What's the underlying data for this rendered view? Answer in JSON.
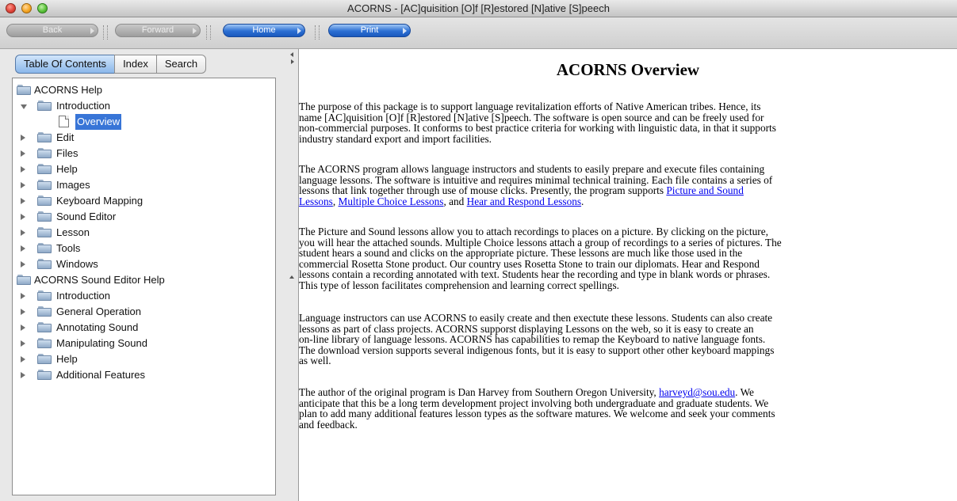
{
  "window": {
    "title": "ACORNS - [AC]quisition [O]f [R]estored [N]ative [S]peech"
  },
  "toolbar": {
    "back_label": "Back",
    "forward_label": "Forward",
    "home_label": "Home",
    "print_label": "Print"
  },
  "tabs": {
    "toc": "Table Of Contents",
    "index": "Index",
    "search": "Search"
  },
  "tree": {
    "acorns_help": "ACORNS Help",
    "introduction": "Introduction",
    "overview": "Overview",
    "edit": "Edit",
    "files": "Files",
    "help": "Help",
    "images": "Images",
    "keyboard_mapping": "Keyboard Mapping",
    "sound_editor": "Sound Editor",
    "lesson": "Lesson",
    "tools": "Tools",
    "windows": "Windows",
    "sound_editor_help": "ACORNS Sound Editor Help",
    "se_introduction": "Introduction",
    "se_general_operation": "General Operation",
    "se_annotating_sound": "Annotating Sound",
    "se_manipulating_sound": "Manipulating Sound",
    "se_help": "Help",
    "se_additional_features": "Additional Features"
  },
  "content": {
    "heading": "ACORNS Overview",
    "p1_line1": "The purpose of this package is to support language revitalization efforts of Native American tribes. Hence, its",
    "p1_line2": "name [AC]quisition [O]f [R]estored [N]ative [S]peech. The software is open source and can be freely used for",
    "p1_line3": "non-commercial purposes. It conforms to best practice criteria for working with linguistic data, in that it supports",
    "p1_line4": "industry standard export and import facilities.",
    "p2_line1": "The ACORNS program allows language instructors and students to easily prepare and execute files containing",
    "p2_line2": "language lessons. The software is intuitive and requires minimal technical training. Each file contains a series of",
    "p2_line3_text": "lessons that link together through use of mouse clicks. Presently, the program supports ",
    "p2_link1_part1": "Picture and Sound",
    "p2_link1_part2": "Lessons",
    "p2_comma": ", ",
    "p2_link2": "Multiple Choice Lessons",
    "p2_and": ", and ",
    "p2_link3": "Hear and Respond Lessons",
    "p2_end": ".",
    "p3_line1": "The Picture and Sound lessons allow you to attach recordings to places on a picture. By clicking on the picture,",
    "p3_line2": "you will hear the attached sounds. Multiple Choice lessons attach a group of recordings to a series of pictures. The",
    "p3_line3": "student hears a sound and clicks on the appropriate picture. These lessons are much like those used in the",
    "p3_line4": "commercial Rosetta Stone product. Our country uses Rosetta Stone to train our diplomats. Hear and Respond",
    "p3_line5": "lessons contain a recording annotated with text. Students hear the recording and type in blank words or phrases.",
    "p3_line6": "This type of lesson facilitates comprehension and learning correct spellings.",
    "p4_line1": "Language instructors can use ACORNS to easily create and then exectute these lessons. Students can also create",
    "p4_line2": "lessons as part of class projects. ACORNS supporst displaying Lessons on the web, so it is easy to create an",
    "p4_line3": "on-line library of language lessons. ACORNS has capabilities to remap the Keyboard to native language fonts.",
    "p4_line4": "The download version supports several indigenous fonts, but it is easy to support other other keyboard mappings",
    "p4_line5": "as well.",
    "p5_line1_text": "The author of the original program is Dan Harvey from Southern Oregon University, ",
    "p5_email": "harveyd@sou.edu",
    "p5_line1_end": ". We",
    "p5_line2": "anticipate that this be a long term development project involving both undergraduate and graduate students. We",
    "p5_line3": "plan to add many additional features lesson types as the software matures. We welcome and seek your comments",
    "p5_line4": "and feedback."
  },
  "colors": {
    "selection": "#3875d7",
    "link": "#0000ee",
    "active_button": "#2c6fd3"
  }
}
